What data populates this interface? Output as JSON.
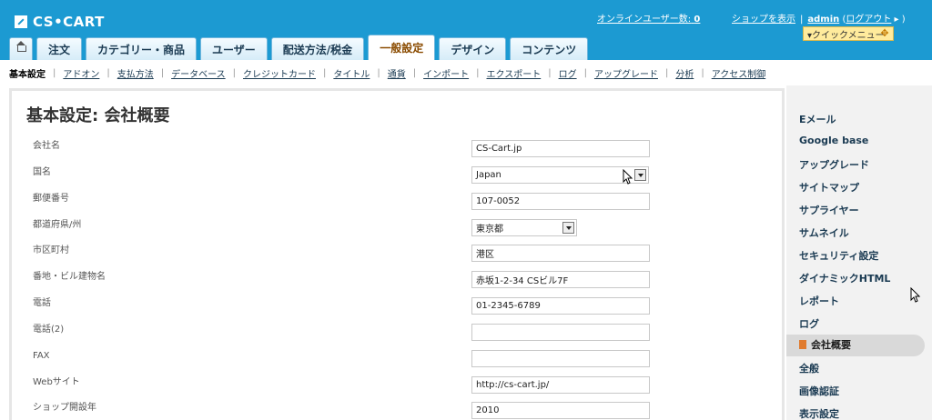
{
  "app": {
    "logo": "CS•CART"
  },
  "header": {
    "online_users_label": "オンラインユーザー数:",
    "online_users_count": "0",
    "view_shop": "ショップを表示",
    "user": "admin",
    "logout": "ログアウト",
    "logout_prefix": "(",
    "logout_suffix": ")",
    "quick_menu": "▾クイックメニュー",
    "quick_menu_move": "✥"
  },
  "tabs": [
    {
      "label": "注文"
    },
    {
      "label": "カテゴリー・商品"
    },
    {
      "label": "ユーザー"
    },
    {
      "label": "配送方法/税金"
    },
    {
      "label": "一般設定",
      "active": true
    },
    {
      "label": "デザイン"
    },
    {
      "label": "コンテンツ"
    }
  ],
  "subnav": [
    {
      "label": "基本設定",
      "active": true
    },
    {
      "label": "アドオン"
    },
    {
      "label": "支払方法"
    },
    {
      "label": "データベース"
    },
    {
      "label": "クレジットカード"
    },
    {
      "label": "タイトル"
    },
    {
      "label": "通貨"
    },
    {
      "label": "インポート"
    },
    {
      "label": "エクスポート"
    },
    {
      "label": "ログ"
    },
    {
      "label": "アップグレード"
    },
    {
      "label": "分析"
    },
    {
      "label": "アクセス制御"
    }
  ],
  "main": {
    "title": "基本設定: 会社概要",
    "fields": [
      {
        "label": "会社名",
        "value": "CS-Cart.jp"
      },
      {
        "label": "国名",
        "value": "Japan"
      },
      {
        "label": "郵便番号",
        "value": "107-0052"
      },
      {
        "label": "都道府県/州",
        "value": "東京都"
      },
      {
        "label": "市区町村",
        "value": "港区"
      },
      {
        "label": "番地・ビル建物名",
        "value": "赤坂1-2-34 CSビル7F"
      },
      {
        "label": "電話",
        "value": "01-2345-6789"
      },
      {
        "label": "電話(2)",
        "value": ""
      },
      {
        "label": "FAX",
        "value": ""
      },
      {
        "label": "Webサイト",
        "value": "http://cs-cart.jp/"
      },
      {
        "label": "ショップ開設年",
        "value": "2010"
      }
    ]
  },
  "sidebar": {
    "items": [
      {
        "label": "Eメール"
      },
      {
        "label": "Google base"
      },
      {
        "label": "アップグレード"
      },
      {
        "label": "サイトマップ"
      },
      {
        "label": "サプライヤー"
      },
      {
        "label": "サムネイル"
      },
      {
        "label": "セキュリティ設定"
      },
      {
        "label": "ダイナミックHTML"
      },
      {
        "label": "レポート"
      },
      {
        "label": "ログ"
      },
      {
        "label": "会社概要",
        "active": true
      },
      {
        "label": "全般"
      },
      {
        "label": "画像認証"
      },
      {
        "label": "表示設定"
      }
    ]
  },
  "colors": {
    "header_bg": "#1c9ad2",
    "active_tab_text": "#8a4b00",
    "link_text": "#1a3a52",
    "quick_menu_bg": "#ffeb9c"
  }
}
